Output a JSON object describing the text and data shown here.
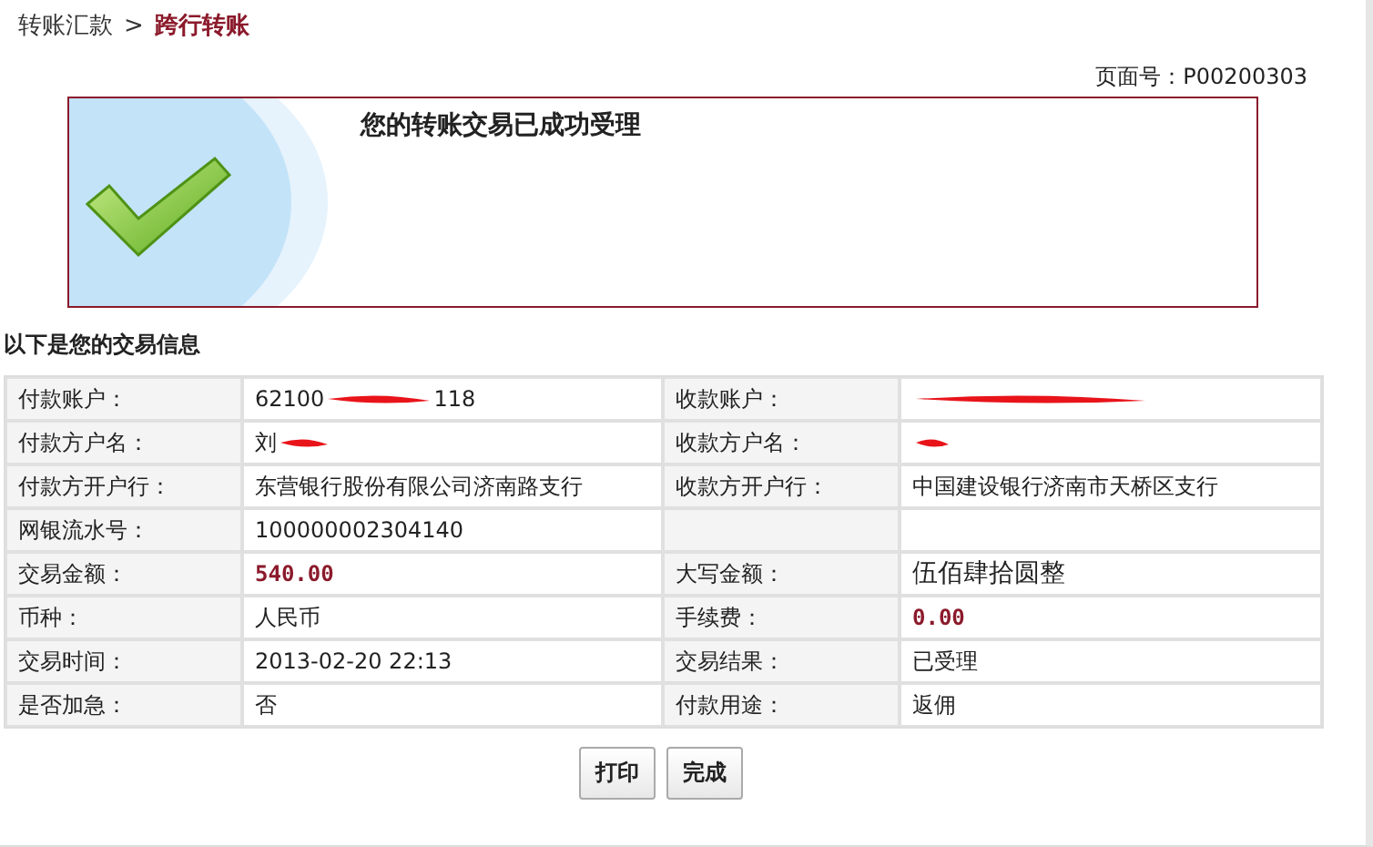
{
  "breadcrumb": {
    "parent": "转账汇款",
    "separator": ">",
    "current": "跨行转账"
  },
  "page_number": "页面号：P00200303",
  "success_banner": {
    "title": "您的转账交易已成功受理"
  },
  "section_title": "以下是您的交易信息",
  "rows": [
    {
      "cells": [
        {
          "label": "付款账户：",
          "value": [
            {
              "kind": "text",
              "text": "62100"
            },
            {
              "kind": "redaction"
            },
            {
              "kind": "text",
              "text": "118"
            }
          ]
        },
        {
          "label": "收款账户：",
          "value": [
            {
              "kind": "redaction"
            }
          ]
        }
      ]
    },
    {
      "cells": [
        {
          "label": "付款方户名：",
          "value": [
            {
              "kind": "text",
              "text": "刘"
            },
            {
              "kind": "redaction"
            }
          ]
        },
        {
          "label": "收款方户名：",
          "value": [
            {
              "kind": "redaction"
            }
          ]
        }
      ]
    },
    {
      "cells": [
        {
          "label": "付款方开户行：",
          "value": [
            {
              "kind": "text",
              "text": "东营银行股份有限公司济南路支行"
            }
          ]
        },
        {
          "label": "收款方开户行：",
          "value": [
            {
              "kind": "text",
              "text": "中国建设银行济南市天桥区支行"
            }
          ]
        }
      ]
    },
    {
      "cells": [
        {
          "label": "网银流水号：",
          "value": [
            {
              "kind": "text",
              "text": "100000002304140"
            }
          ]
        },
        {}
      ]
    },
    {
      "cells": [
        {
          "label": "交易金额：",
          "value": [
            {
              "kind": "amount",
              "text": "540.00"
            }
          ]
        },
        {
          "label": "大写金额：",
          "value": [
            {
              "kind": "large",
              "text": "伍佰肆拾圆整"
            }
          ]
        }
      ]
    },
    {
      "cells": [
        {
          "label": "币种：",
          "value": [
            {
              "kind": "text",
              "text": "人民币"
            }
          ]
        },
        {
          "label": "手续费：",
          "value": [
            {
              "kind": "amount",
              "text": "0.00"
            }
          ]
        }
      ]
    },
    {
      "cells": [
        {
          "label": "交易时间：",
          "value": [
            {
              "kind": "text",
              "text": "2013-02-20 22:13"
            }
          ]
        },
        {
          "label": "交易结果：",
          "value": [
            {
              "kind": "text",
              "text": "已受理"
            }
          ]
        }
      ]
    },
    {
      "cells": [
        {
          "label": "是否加急：",
          "value": [
            {
              "kind": "text",
              "text": "否"
            }
          ]
        },
        {
          "label": "付款用途：",
          "value": [
            {
              "kind": "text",
              "text": "返佣"
            }
          ]
        }
      ]
    }
  ],
  "buttons": [
    "打印",
    "完成"
  ]
}
